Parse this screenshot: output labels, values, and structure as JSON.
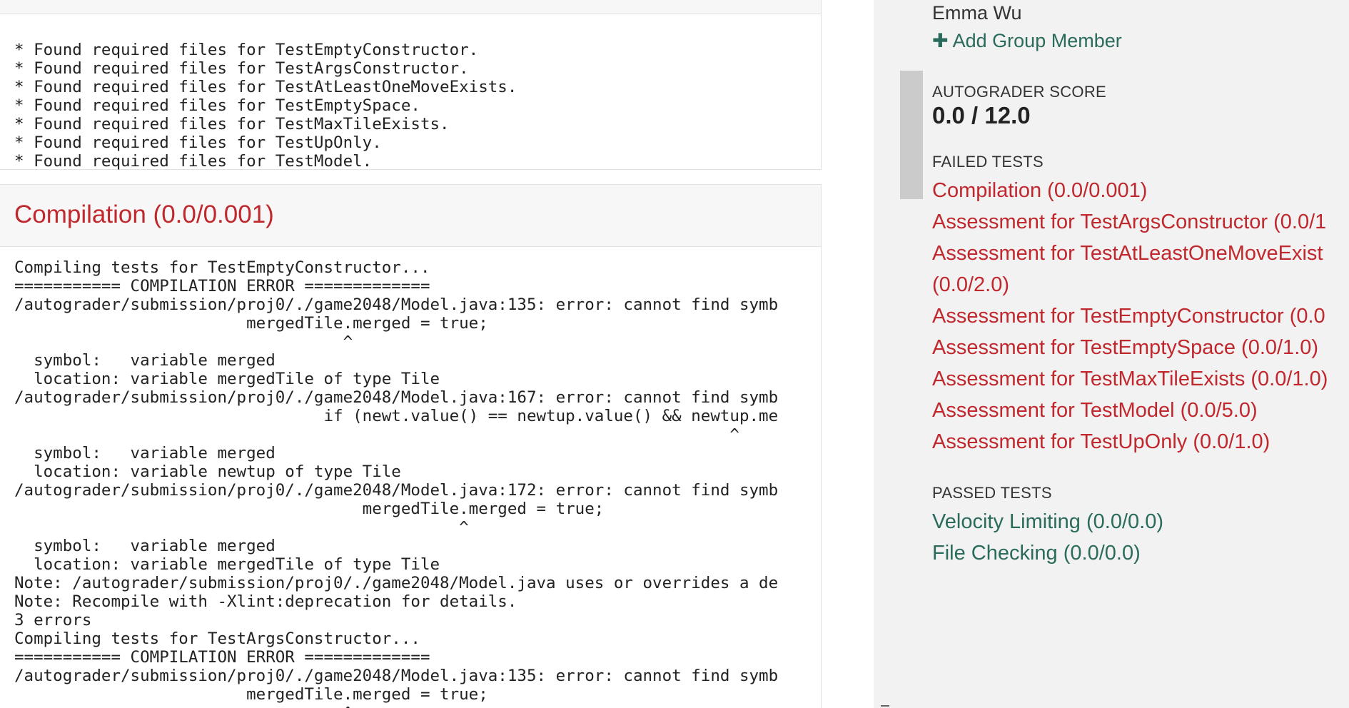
{
  "file_check_output": {
    "lines": [
      "* Found required files for TestEmptyConstructor.",
      "* Found required files for TestArgsConstructor.",
      "* Found required files for TestAtLeastOneMoveExists.",
      "* Found required files for TestEmptySpace.",
      "* Found required files for TestMaxTileExists.",
      "* Found required files for TestUpOnly.",
      "* Found required files for TestModel."
    ]
  },
  "compilation_section": {
    "title": "Compilation (0.0/0.001)",
    "output_lines": [
      "Compiling tests for TestEmptyConstructor...",
      "=========== COMPILATION ERROR =============",
      "/autograder/submission/proj0/./game2048/Model.java:135: error: cannot find symb",
      "                        mergedTile.merged = true;",
      "                                  ^",
      "  symbol:   variable merged",
      "  location: variable mergedTile of type Tile",
      "/autograder/submission/proj0/./game2048/Model.java:167: error: cannot find symb",
      "                                if (newt.value() == newtup.value() && newtup.me",
      "                                                                          ^",
      "  symbol:   variable merged",
      "  location: variable newtup of type Tile",
      "/autograder/submission/proj0/./game2048/Model.java:172: error: cannot find symb",
      "                                    mergedTile.merged = true;",
      "                                              ^",
      "  symbol:   variable merged",
      "  location: variable mergedTile of type Tile",
      "Note: /autograder/submission/proj0/./game2048/Model.java uses or overrides a de",
      "Note: Recompile with -Xlint:deprecation for details.",
      "3 errors",
      "Compiling tests for TestArgsConstructor...",
      "=========== COMPILATION ERROR =============",
      "/autograder/submission/proj0/./game2048/Model.java:135: error: cannot find symb",
      "                        mergedTile.merged = true;",
      "                                  ^"
    ]
  },
  "sidebar": {
    "member_name": "Emma Wu",
    "add_member_icon": "plus-icon",
    "add_member_label": "Add Group Member",
    "score_label": "AUTOGRADER SCORE",
    "score_value": "0.0 / 12.0",
    "failed_label": "FAILED TESTS",
    "failed_tests": [
      "Compilation (0.0/0.001)",
      "Assessment for TestArgsConstructor (0.0/1",
      "Assessment for TestAtLeastOneMoveExist",
      "(0.0/2.0)",
      "Assessment for TestEmptyConstructor (0.0",
      "Assessment for TestEmptySpace (0.0/1.0)",
      "Assessment for TestMaxTileExists (0.0/1.0)",
      "Assessment for TestModel (0.0/5.0)",
      "Assessment for TestUpOnly (0.0/1.0)"
    ],
    "passed_label": "PASSED TESTS",
    "passed_tests": [
      "Velocity Limiting (0.0/0.0)",
      "File Checking (0.0/0.0)"
    ]
  },
  "colors": {
    "failed": "#c0282d",
    "passed": "#2a6b5c",
    "sidebar_bg": "#f2f2f2"
  }
}
